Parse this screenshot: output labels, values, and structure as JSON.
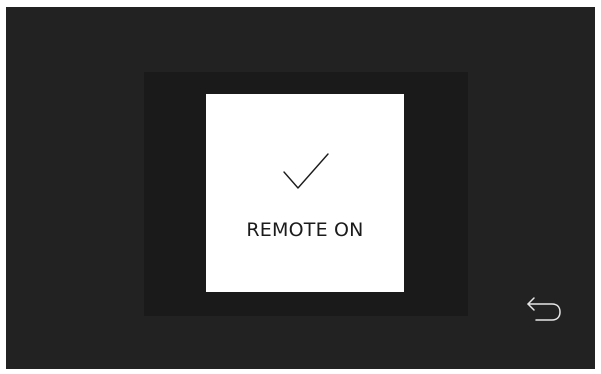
{
  "colors": {
    "screen_background": "#222222",
    "backdrop": "#1a1a1a",
    "card_background": "#ffffff",
    "card_text": "#1b1b1b",
    "icon_stroke_dark": "#1b1b1b",
    "icon_stroke_light": "#e6e6e6"
  },
  "modal": {
    "icon": "checkmark-icon",
    "message": "REMOTE ON"
  },
  "navigation": {
    "back_icon": "back-arrow-icon"
  }
}
